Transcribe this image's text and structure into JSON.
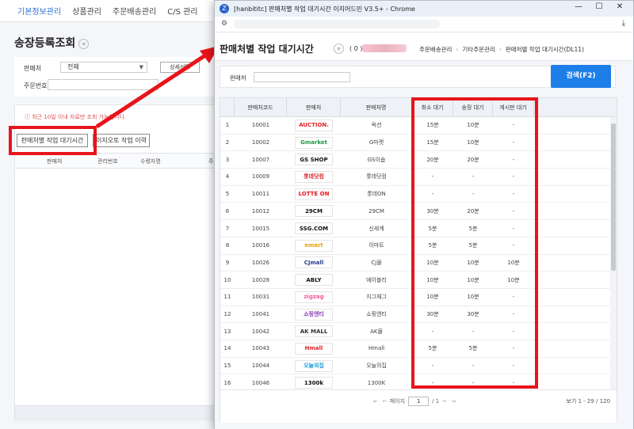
{
  "background": {
    "nav_items": [
      {
        "label": "기본정보관리",
        "active": true
      },
      {
        "label": "상품관리",
        "active": false
      },
      {
        "label": "주문배송관리",
        "active": false
      },
      {
        "label": "C/S 관리",
        "active": false
      }
    ],
    "page_title": "송장등록조회",
    "form": {
      "seller_label": "판매처",
      "seller_value": "전체",
      "detail_button": "상세선택",
      "order_no_label": "주문번호"
    },
    "notice": "ⓘ 최근 10일 이내 자료만 조회 가능합니다.",
    "buttons": {
      "wait_time": "판매처별 작업 대기시간",
      "history": "이지오토 작업 이력"
    },
    "table_headers": [
      "판매처",
      "관리번호",
      "수령자명",
      "주"
    ]
  },
  "popup": {
    "window_title": "[hanbititc] 판매처별 작업 대기시간 이지어드민 V3.5+ - Chrome",
    "window_controls": {
      "minimize": "—",
      "maximize": "☐",
      "close": "✕"
    },
    "page_title": "판매처별 작업 대기시간",
    "count_text": "( 0 )",
    "breadcrumbs": [
      "주문배송관리",
      "기타주문관리",
      "판매처별 작업 대기시간(DL11)"
    ],
    "search": {
      "label": "판매처",
      "value": "",
      "button": "검색(F2)"
    },
    "grid": {
      "headers": [
        "판매처코드",
        "판매처",
        "판매처명",
        "취소 대기",
        "송장 대기",
        "게시판 대기"
      ],
      "rows": [
        {
          "no": "1",
          "code": "10001",
          "logo": "AUCTION.",
          "logo_color": "#e4232a",
          "name": "옥션",
          "cancel": "15분",
          "invoice": "10분",
          "board": "-"
        },
        {
          "no": "2",
          "code": "10002",
          "logo": "Gmarket",
          "logo_color": "#1c9c3e",
          "name": "G마켓",
          "cancel": "15분",
          "invoice": "10분",
          "board": "-"
        },
        {
          "no": "3",
          "code": "10007",
          "logo": "GS SHOP",
          "logo_color": "#111111",
          "name": "GS이숍",
          "cancel": "20분",
          "invoice": "20분",
          "board": "-"
        },
        {
          "no": "4",
          "code": "10009",
          "logo": "롯데닷컴",
          "logo_color": "#d9252b",
          "name": "롯데닷컴",
          "cancel": "-",
          "invoice": "-",
          "board": "-"
        },
        {
          "no": "5",
          "code": "10011",
          "logo": "LOTTE ON",
          "logo_color": "#e8141b",
          "name": "롯데ON",
          "cancel": "-",
          "invoice": "-",
          "board": "-"
        },
        {
          "no": "6",
          "code": "10012",
          "logo": "29CM",
          "logo_color": "#111111",
          "name": "29CM",
          "cancel": "30분",
          "invoice": "20분",
          "board": "-"
        },
        {
          "no": "7",
          "code": "10015",
          "logo": "SSG.COM",
          "logo_color": "#111111",
          "name": "신세계",
          "cancel": "5분",
          "invoice": "5분",
          "board": "-"
        },
        {
          "no": "8",
          "code": "10016",
          "logo": "emart",
          "logo_color": "#e8a200",
          "name": "이마트",
          "cancel": "5분",
          "invoice": "5분",
          "board": "-"
        },
        {
          "no": "9",
          "code": "10026",
          "logo": "CJmall",
          "logo_color": "#2a3a8c",
          "name": "CJ몰",
          "cancel": "10분",
          "invoice": "10분",
          "board": "10분"
        },
        {
          "no": "10",
          "code": "10028",
          "logo": "ABLY",
          "logo_color": "#111111",
          "name": "에이블리",
          "cancel": "10분",
          "invoice": "10분",
          "board": "10분"
        },
        {
          "no": "11",
          "code": "10031",
          "logo": "zigzag",
          "logo_color": "#f05a9c",
          "name": "지그재그",
          "cancel": "10분",
          "invoice": "10분",
          "board": "-"
        },
        {
          "no": "12",
          "code": "10041",
          "logo": "쇼핑엔티",
          "logo_color": "#8a3bb8",
          "name": "쇼핑엔티",
          "cancel": "30분",
          "invoice": "30분",
          "board": "-"
        },
        {
          "no": "13",
          "code": "10042",
          "logo": "AK MALL",
          "logo_color": "#333333",
          "name": "AK몰",
          "cancel": "-",
          "invoice": "-",
          "board": "-"
        },
        {
          "no": "14",
          "code": "10043",
          "logo": "Hmall",
          "logo_color": "#d9252b",
          "name": "Hmall",
          "cancel": "5분",
          "invoice": "5분",
          "board": "-"
        },
        {
          "no": "15",
          "code": "10044",
          "logo": "오늘의집",
          "logo_color": "#1f9bd6",
          "name": "오늘의집",
          "cancel": "-",
          "invoice": "-",
          "board": "-"
        },
        {
          "no": "16",
          "code": "10046",
          "logo": "1300k",
          "logo_color": "#111111",
          "name": "1300K",
          "cancel": "-",
          "invoice": "-",
          "board": "-"
        }
      ]
    },
    "pager": {
      "page_label": "페이지",
      "current_page": "1",
      "total_pages": "/ 1",
      "view_info": "보기 1 - 29 / 120"
    }
  }
}
